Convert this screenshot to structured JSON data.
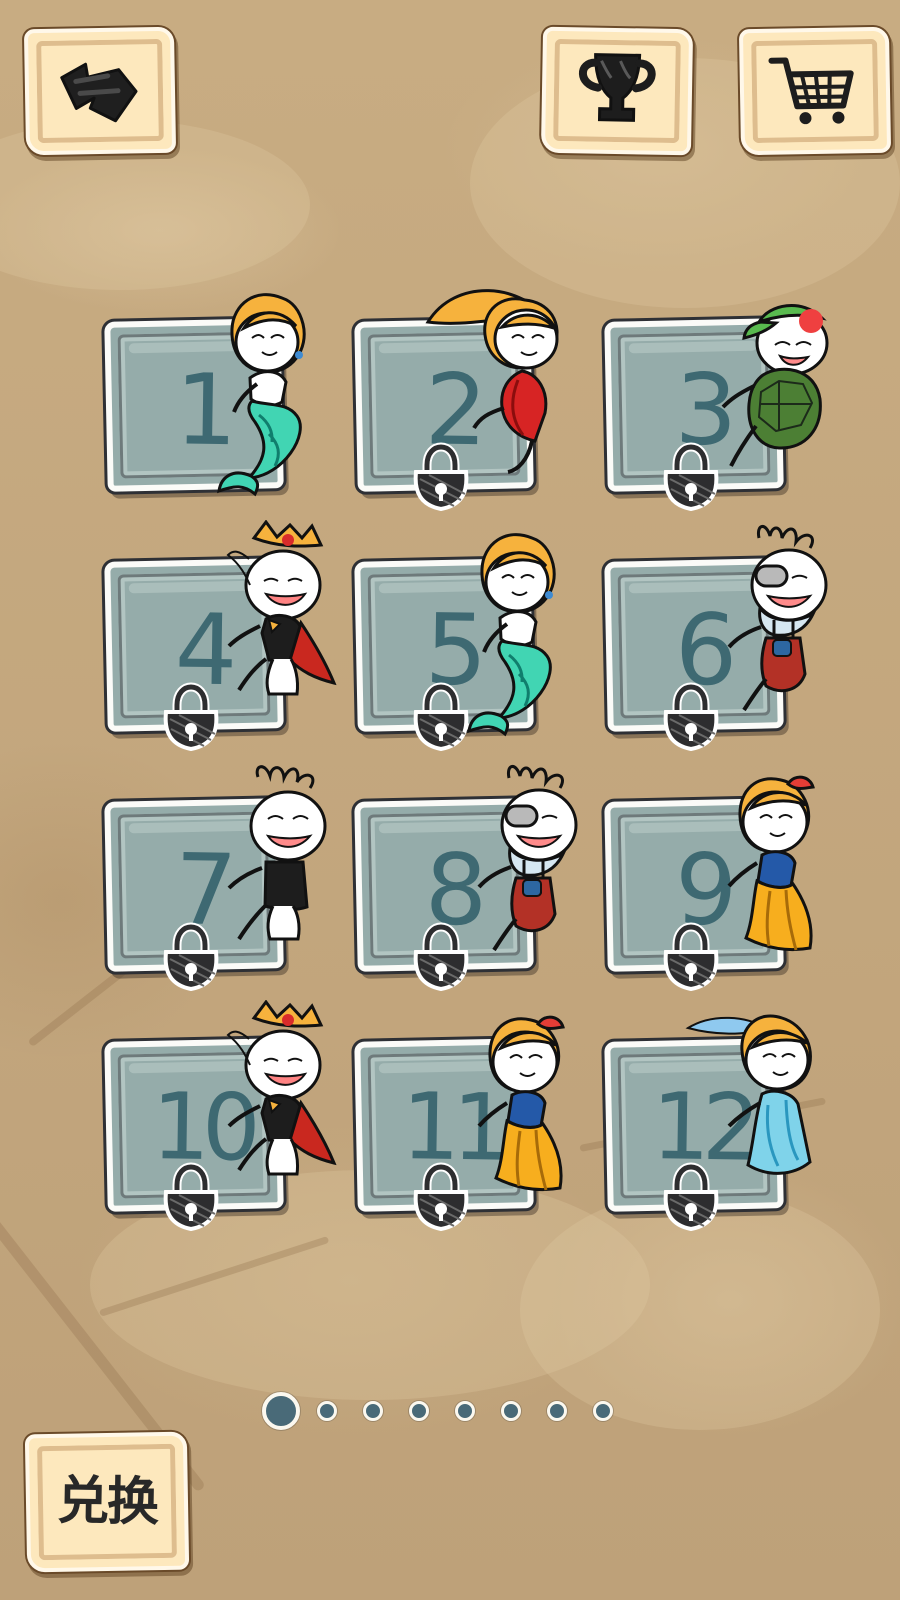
{
  "top_bar": {
    "back_icon": "back-icon",
    "trophy_icon": "trophy-icon",
    "cart_icon": "cart-icon"
  },
  "levels": [
    {
      "number": "1",
      "locked": false,
      "character": "mermaid"
    },
    {
      "number": "2",
      "locked": true,
      "character": "long-hair-girl"
    },
    {
      "number": "3",
      "locked": true,
      "character": "turtle-boy"
    },
    {
      "number": "4",
      "locked": true,
      "character": "king"
    },
    {
      "number": "5",
      "locked": true,
      "character": "mermaid"
    },
    {
      "number": "6",
      "locked": true,
      "character": "old-man-overalls"
    },
    {
      "number": "7",
      "locked": true,
      "character": "crying-boy"
    },
    {
      "number": "8",
      "locked": true,
      "character": "old-man-overalls"
    },
    {
      "number": "9",
      "locked": true,
      "character": "yellow-dress-girl"
    },
    {
      "number": "10",
      "locked": true,
      "character": "king"
    },
    {
      "number": "11",
      "locked": true,
      "character": "yellow-dress-girl"
    },
    {
      "number": "12",
      "locked": true,
      "character": "ice-princess"
    }
  ],
  "pager": {
    "count": 8,
    "active_index": 0
  },
  "redeem": {
    "label": "兑换"
  },
  "colors": {
    "background": "#c6aa80",
    "tile": "#95acaa",
    "number": "#3e6972",
    "button_paper": "#fde8bd",
    "lock": "#2d2d2f"
  }
}
